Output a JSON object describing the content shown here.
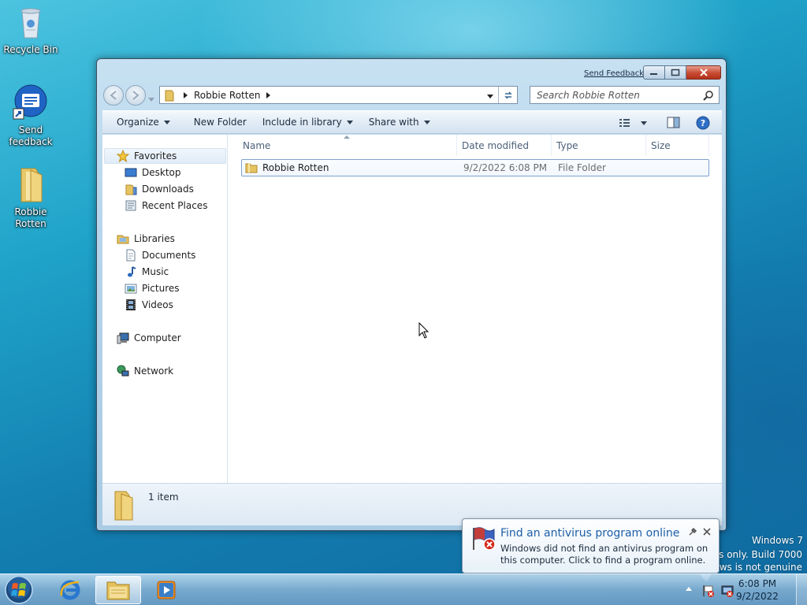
{
  "desktop": {
    "icons": [
      {
        "label": "Recycle Bin"
      },
      {
        "label": "Send feedback"
      },
      {
        "label": "Robbie Rotten"
      }
    ],
    "watermark": {
      "line1": "Windows 7",
      "line2": "For testing purposes only. Build 7000",
      "line3": "This copy of Windows is not genuine"
    }
  },
  "window": {
    "send_feedback": "Send Feedback",
    "address": {
      "segment": "Robbie Rotten"
    },
    "search_placeholder": "Search Robbie Rotten",
    "toolbar": {
      "organize": "Organize",
      "new_folder": "New Folder",
      "include_in_library": "Include in library",
      "share_with": "Share with"
    },
    "nav": {
      "favorites": "Favorites",
      "desktop": "Desktop",
      "downloads": "Downloads",
      "recent_places": "Recent Places",
      "libraries": "Libraries",
      "documents": "Documents",
      "music": "Music",
      "pictures": "Pictures",
      "videos": "Videos",
      "computer": "Computer",
      "network": "Network"
    },
    "columns": {
      "name": "Name",
      "date_modified": "Date modified",
      "type": "Type",
      "size": "Size"
    },
    "files": [
      {
        "name": "Robbie Rotten",
        "date_modified": "9/2/2022 6:08 PM",
        "type": "File Folder",
        "size": ""
      }
    ],
    "status": {
      "item_count": "1 item"
    }
  },
  "notification": {
    "title": "Find an antivirus program online",
    "body": "Windows did not find an antivirus program on this computer. Click to find a program online."
  },
  "taskbar": {
    "clock_time": "6:08 PM",
    "clock_date": "9/2/2022"
  },
  "colors": {
    "accent": "#1e5fa8",
    "notification_title": "#1e5fa8",
    "close_button": "#c74a32"
  }
}
